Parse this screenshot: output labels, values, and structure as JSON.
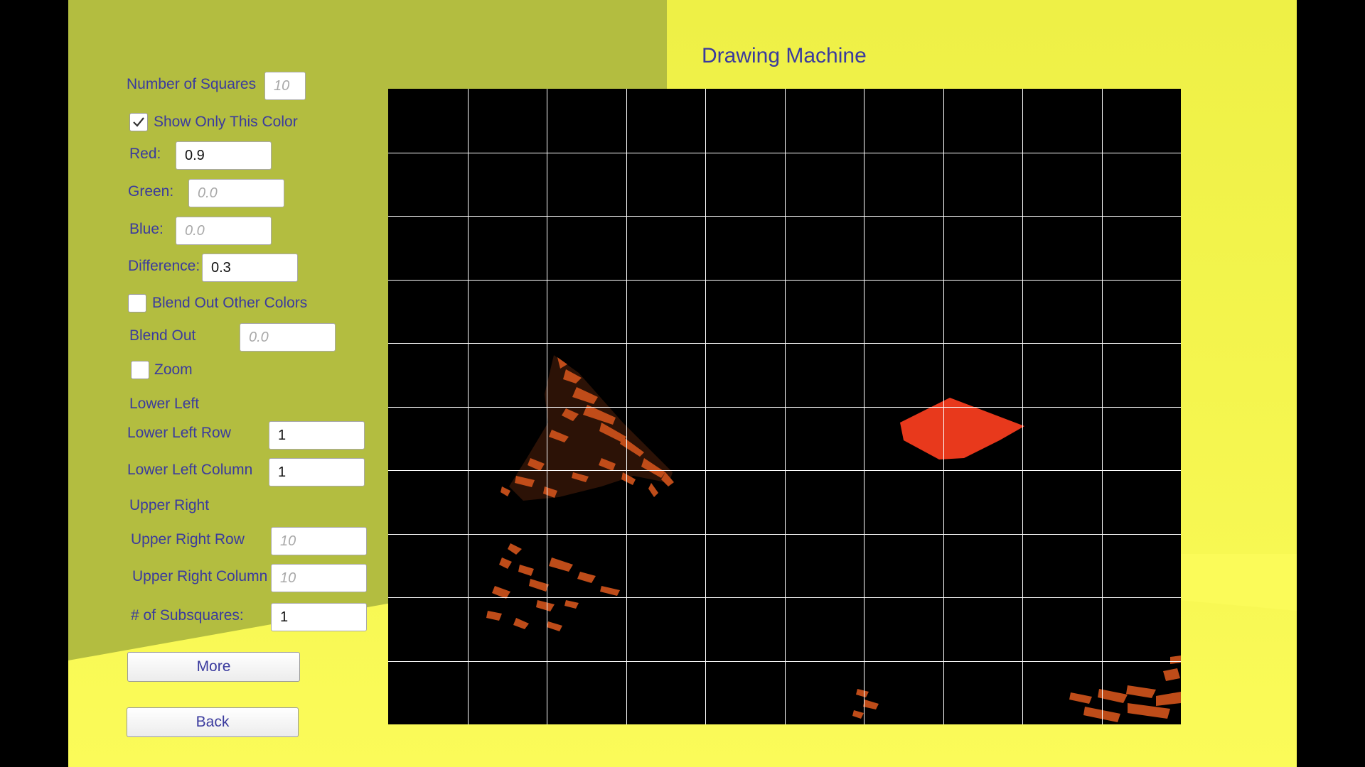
{
  "title": "Drawing Machine",
  "controls": {
    "num_squares": {
      "label": "Number of Squares",
      "placeholder": "10"
    },
    "show_only": {
      "label": "Show Only This Color",
      "checked": true
    },
    "red": {
      "label": "Red:",
      "value": "0.9"
    },
    "green": {
      "label": "Green:",
      "placeholder": "0.0"
    },
    "blue": {
      "label": "Blue:",
      "placeholder": "0.0"
    },
    "difference": {
      "label": "Difference:",
      "value": "0.3"
    },
    "blend_out_other": {
      "label": "Blend Out Other Colors",
      "checked": false
    },
    "blend_out": {
      "label": "Blend Out",
      "placeholder": "0.0"
    },
    "zoom": {
      "label": "Zoom",
      "checked": false
    },
    "lower_left": {
      "heading": "Lower Left",
      "row": {
        "label": "Lower Left Row",
        "value": "1"
      },
      "column": {
        "label": "Lower Left Column",
        "value": "1"
      }
    },
    "upper_right": {
      "heading": "Upper Right",
      "row": {
        "label": "Upper Right Row",
        "placeholder": "10"
      },
      "column": {
        "label": "Upper Right Column",
        "placeholder": "10"
      }
    },
    "subsquares": {
      "label": "# of Subsquares:",
      "value": "1"
    }
  },
  "buttons": {
    "more": "More",
    "back": "Back"
  },
  "colors": {
    "label_text": "#3a3a9e",
    "panel_olive": "#b3bd40",
    "background_yellow": "#f4f54e",
    "canvas_bg": "#000000",
    "grid_line": "#ffffff",
    "highlight_orange": "#c8501a",
    "highlight_red": "#e8391c"
  },
  "grid": {
    "rows": 10,
    "columns": 10
  }
}
